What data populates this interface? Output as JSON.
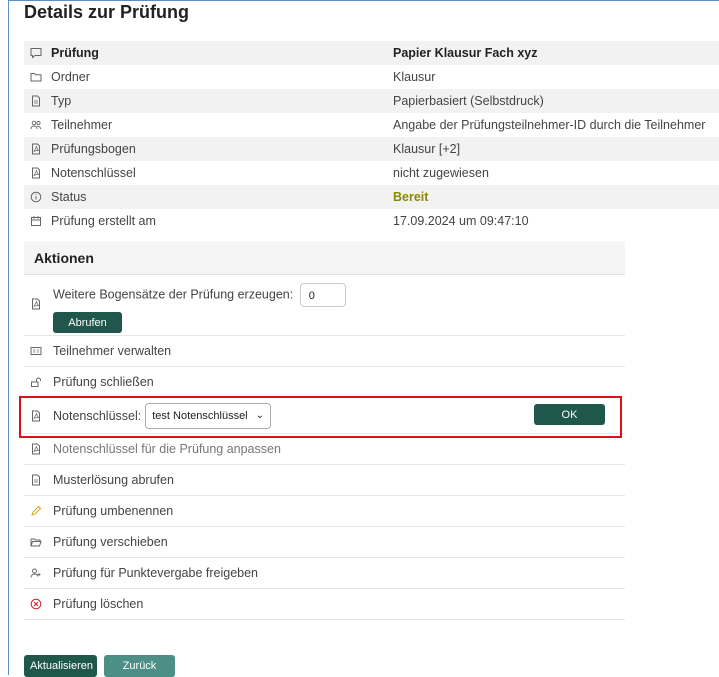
{
  "page": {
    "title": "Details zur Prüfung"
  },
  "details": [
    {
      "icon": "speech-bubble-icon",
      "label": "Prüfung",
      "value": "Papier Klausur Fach xyz"
    },
    {
      "icon": "folder-icon",
      "label": "Ordner",
      "value": "Klausur"
    },
    {
      "icon": "document-icon",
      "label": "Typ",
      "value": "Papierbasiert (Selbstdruck)"
    },
    {
      "icon": "users-icon",
      "label": "Teilnehmer",
      "value": "Angabe der Prüfungsteilnehmer-ID durch die Teilnehmer"
    },
    {
      "icon": "pdf-icon",
      "label": "Prüfungsbogen",
      "value": "Klausur [+2]"
    },
    {
      "icon": "pdf-icon",
      "label": "Notenschlüssel",
      "value": "nicht zugewiesen"
    },
    {
      "icon": "info-icon",
      "label": "Status",
      "value": "Bereit"
    },
    {
      "icon": "calendar-icon",
      "label": "Prüfung erstellt am",
      "value": "17.09.2024 um 09:47:10"
    }
  ],
  "actions": {
    "title": "Aktionen",
    "generate_label": "Weitere Bogensätze der Prüfung erzeugen:",
    "generate_value": "0",
    "abrufen_label": "Abrufen",
    "manage_participants": "Teilnehmer verwalten",
    "close_exam": "Prüfung schließen",
    "grading_key_label": "Notenschlüssel:",
    "grading_key_selected": "test Notenschlüssel",
    "ok_label": "OK",
    "adjust_grading_key": "Notenschlüssel für die Prüfung anpassen",
    "sample_solution": "Musterlösung abrufen",
    "rename": "Prüfung umbenennen",
    "move": "Prüfung verschieben",
    "release_points": "Prüfung für Punktevergabe freigeben",
    "delete": "Prüfung löschen"
  },
  "buttons": {
    "refresh": "Aktualisieren",
    "back": "Zurück"
  },
  "colors": {
    "primary": "#20574d",
    "secondary": "#4c8f86",
    "highlight": "#e0101a",
    "status_ready": "#8a8a00"
  }
}
